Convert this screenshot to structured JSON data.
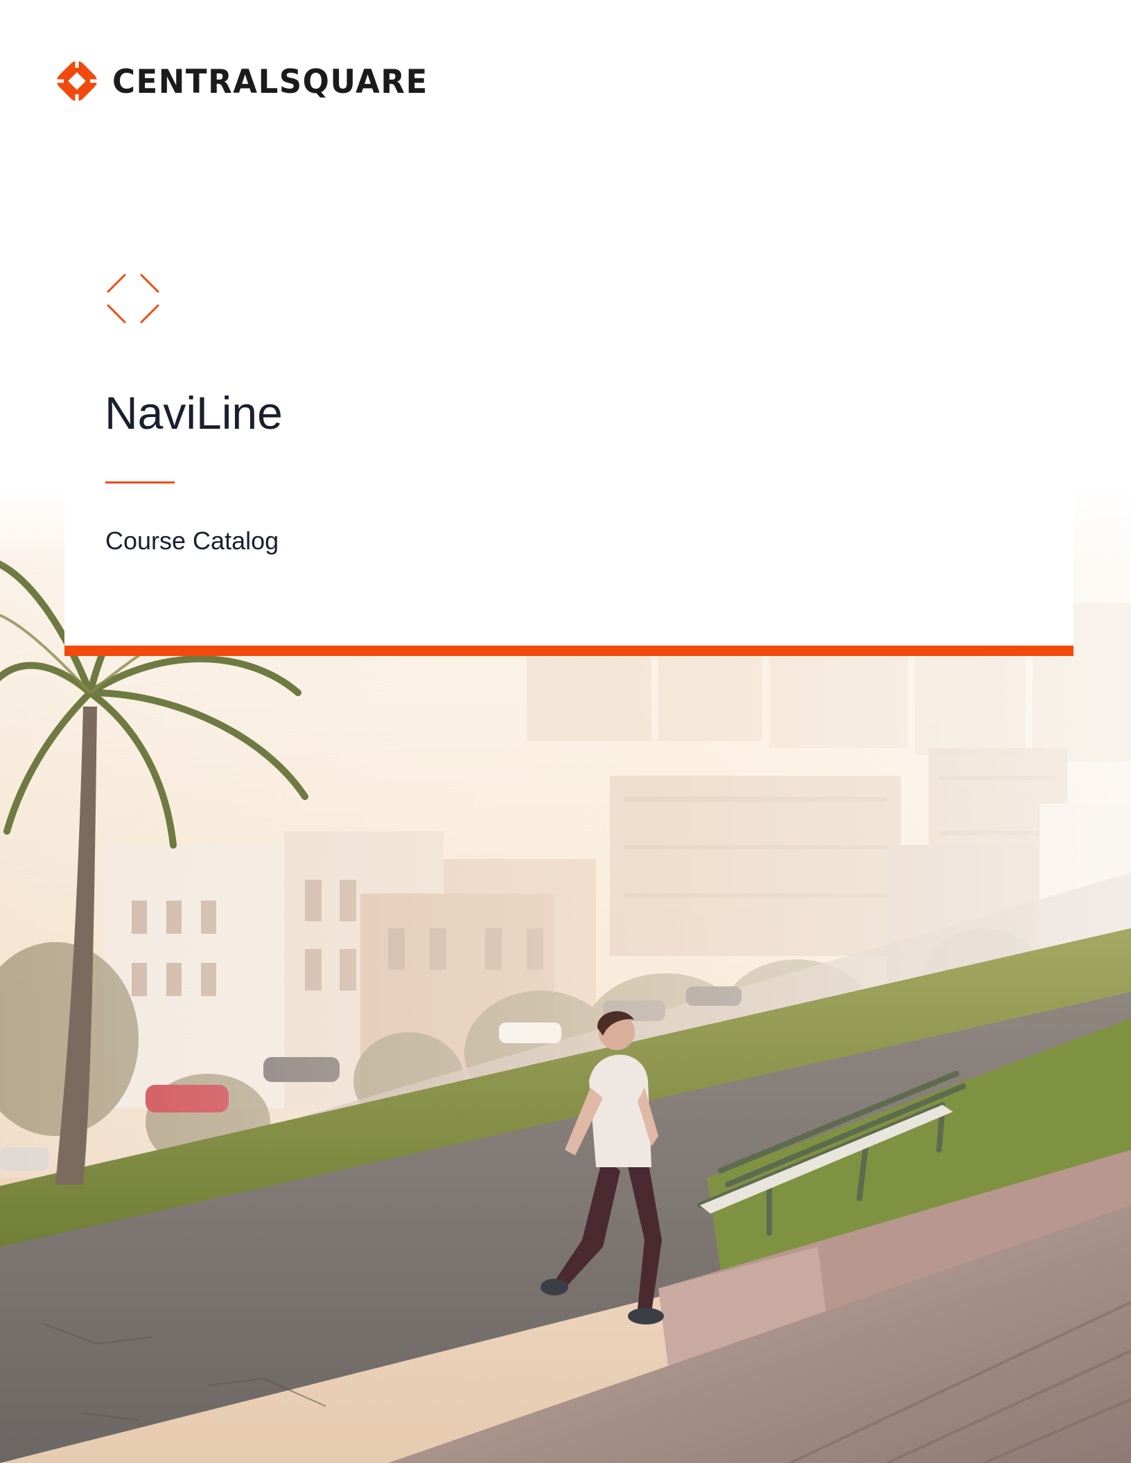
{
  "brand": {
    "name": "CENTRALSQUARE",
    "accent_color": "#f24a0c",
    "icon": "diamond-logo-icon"
  },
  "cover": {
    "icon": "chevron-diamond-icon",
    "title": "NaviLine",
    "subtitle": "Course Catalog"
  },
  "photo": {
    "icon": "city-park-photo"
  }
}
